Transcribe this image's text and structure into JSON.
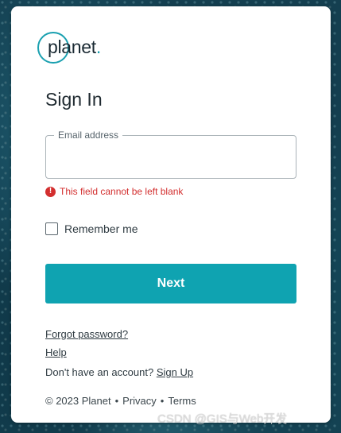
{
  "logo": {
    "text": "planet",
    "dot": "."
  },
  "title": "Sign In",
  "email": {
    "label": "Email address",
    "value": "",
    "placeholder": ""
  },
  "error": {
    "icon": "!",
    "message": "This field cannot be left blank"
  },
  "remember": {
    "label": "Remember me",
    "checked": false
  },
  "next_label": "Next",
  "links": {
    "forgot": "Forgot password?",
    "help": "Help",
    "no_account": "Don't have an account?",
    "signup": "Sign Up"
  },
  "footer": {
    "copyright": "© 2023 Planet",
    "sep1": "•",
    "privacy": "Privacy",
    "sep2": "•",
    "terms": "Terms"
  },
  "watermark": "CSDN @GIS与Web开发",
  "colors": {
    "accent": "#0fa3b1",
    "error": "#d32f2f",
    "text": "#2f3b42"
  }
}
